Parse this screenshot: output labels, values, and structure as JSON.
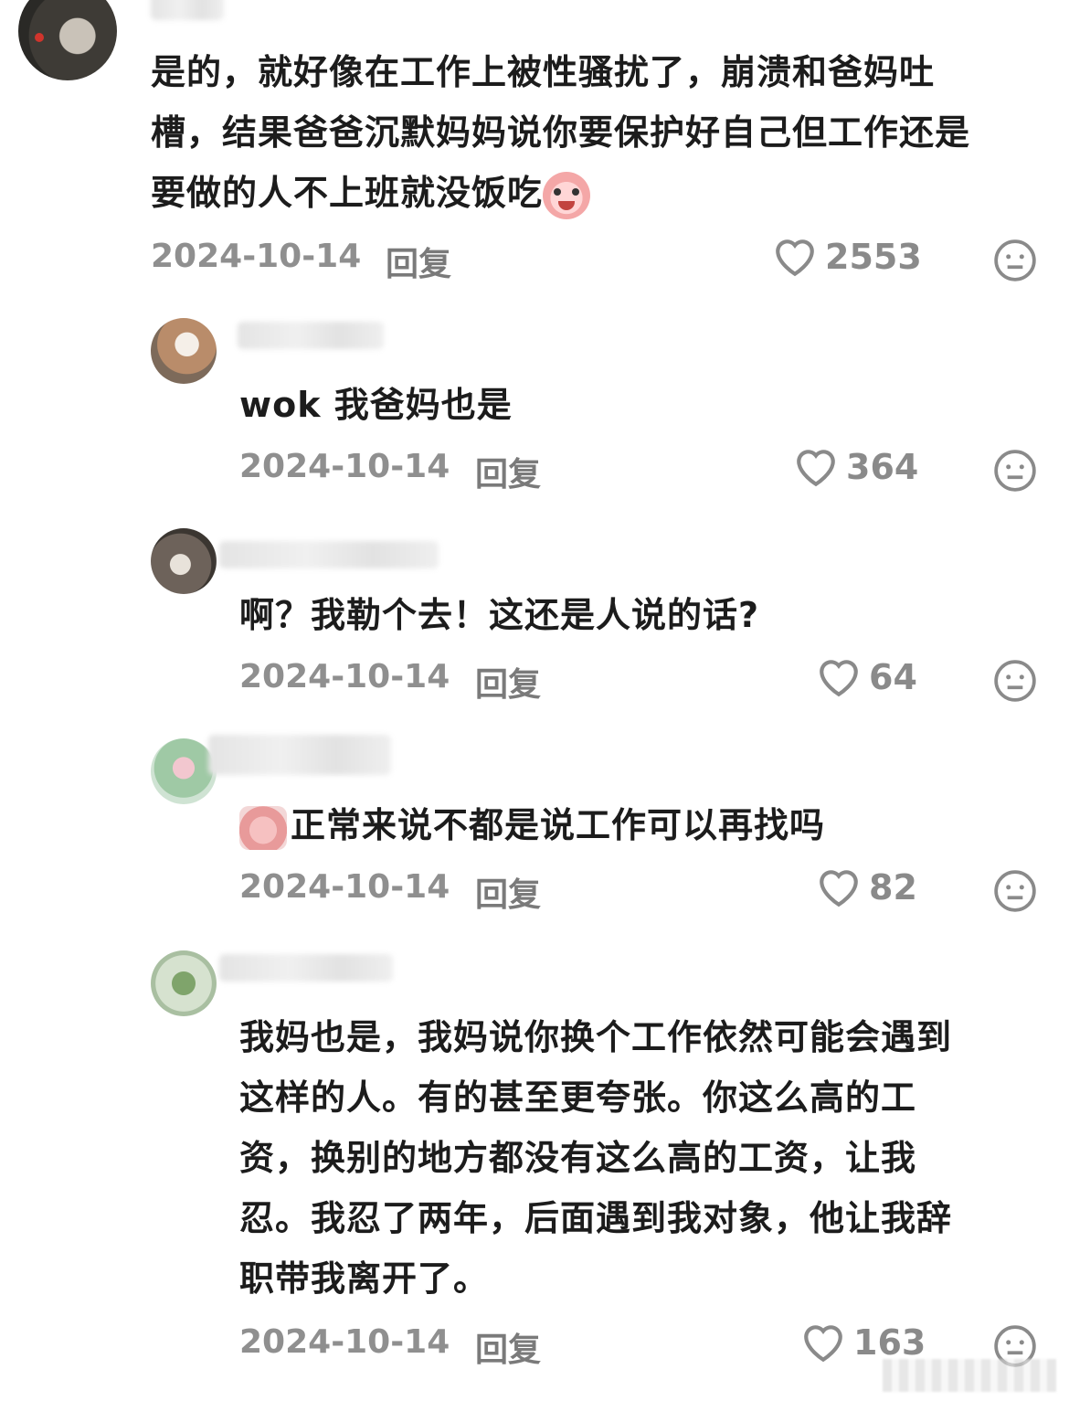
{
  "comments": [
    {
      "text_lines": [
        "是的，就好像在工作上被性骚扰了，崩溃和爸妈吐",
        "槽，结果爸爸沉默妈妈说你要保护好自己但工作还是",
        "要做的人不上班就没饭吃"
      ],
      "date": "2024-10-14",
      "reply_label": "回复",
      "likes": "2553",
      "emoji_icon": "crying-face-emoji"
    },
    {
      "text_lines": [
        "wok 我爸妈也是"
      ],
      "date": "2024-10-14",
      "reply_label": "回复",
      "likes": "364"
    },
    {
      "text_lines": [
        "啊？我勒个去！这还是人说的话?"
      ],
      "date": "2024-10-14",
      "reply_label": "回复",
      "likes": "64"
    },
    {
      "text_lines": [
        "正常来说不都是说工作可以再找吗"
      ],
      "date": "2024-10-14",
      "reply_label": "回复",
      "likes": "82",
      "sticker_icon": "sad-sticker-emoji"
    },
    {
      "text_lines": [
        "我妈也是，我妈说你换个工作依然可能会遇到",
        "这样的人。有的甚至更夸张。你这么高的工",
        "资，换别的地方都没有这么高的工资，让我",
        "忍。我忍了两年，后面遇到我对象，他让我辞",
        "职带我离开了。"
      ],
      "date": "2024-10-14",
      "reply_label": "回复",
      "likes": "163"
    }
  ],
  "colors": {
    "text": "#1c1c1c",
    "meta": "#8f8f8f",
    "icon": "#8a8a8a"
  },
  "icons": {
    "like": "heart-outline-icon",
    "dislike": "neutral-face-icon"
  }
}
